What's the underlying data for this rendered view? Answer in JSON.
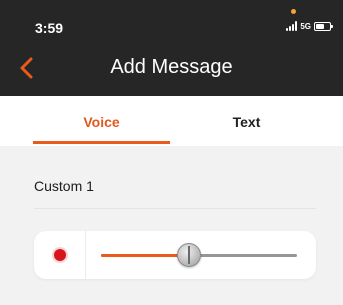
{
  "status_bar": {
    "time": "3:59",
    "network": "5G",
    "icons": [
      "signal-icon",
      "battery-icon"
    ]
  },
  "header": {
    "title": "Add Message",
    "back_icon": "chevron-left-icon"
  },
  "tabs": [
    {
      "label": "Voice",
      "selected": true
    },
    {
      "label": "Text",
      "selected": false
    }
  ],
  "message": {
    "label": "Custom 1"
  },
  "player": {
    "record_icon": "record-dot-icon",
    "progress": 0.45
  },
  "colors": {
    "accent": "#ea5a1c",
    "header_bg": "#262626",
    "record": "#d8141c"
  }
}
